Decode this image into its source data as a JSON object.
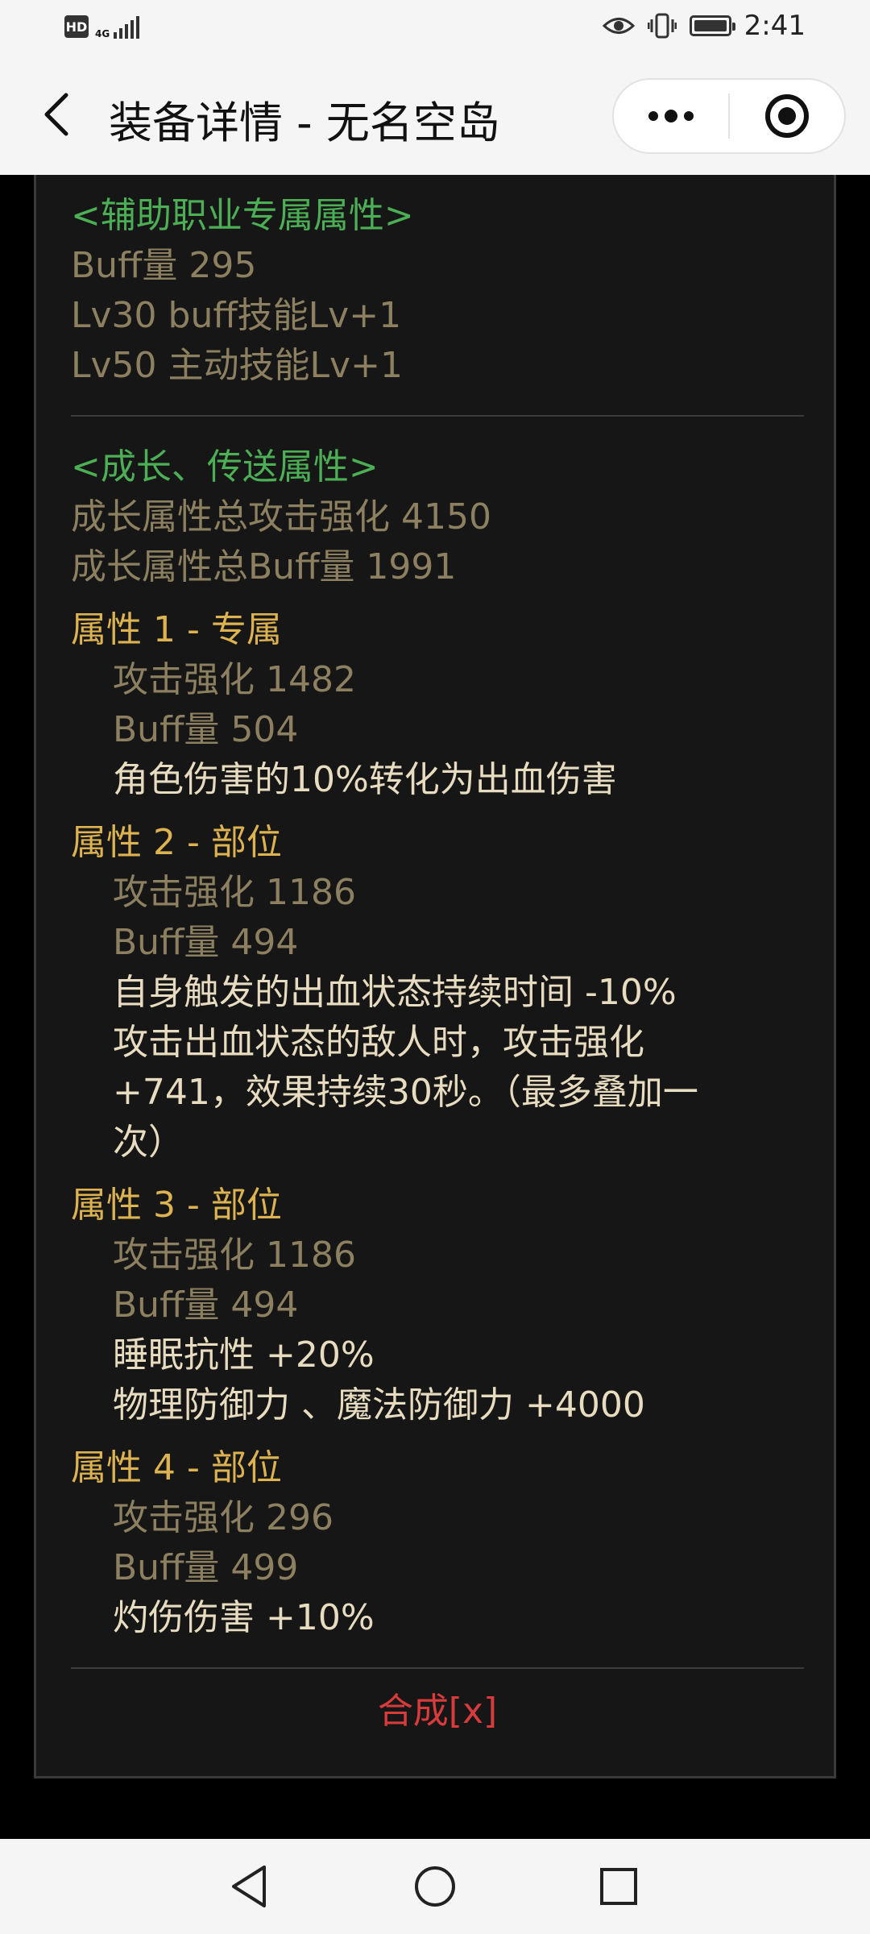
{
  "status": {
    "hd": "HD",
    "network": "4G",
    "time": "2:41"
  },
  "header": {
    "title": "装备详情 - 无名空岛",
    "more_icon": "more-dots-icon",
    "target_icon": "target-icon"
  },
  "support": {
    "heading": "<辅助职业专属属性>",
    "lines": [
      "Buff量   295",
      "Lv30 buff技能Lv+1",
      "Lv50 主动技能Lv+1"
    ]
  },
  "growth": {
    "heading": "<成长、传送属性>",
    "total_attack": "成长属性总攻击强化 4150",
    "total_buff": "成长属性总Buff量 1991"
  },
  "attributes": [
    {
      "title": "属性 1 - 专属",
      "attack": "攻击强化   1482",
      "buff": "Buff量   504",
      "effects": [
        "角色伤害的10%转化为出血伤害"
      ]
    },
    {
      "title": "属性 2 - 部位",
      "attack": "攻击强化   1186",
      "buff": "Buff量   494",
      "effects": [
        "自身触发的出血状态持续时间 -10%",
        "攻击出血状态的敌人时，攻击强化+741，效果持续30秒。（最多叠加一次）"
      ]
    },
    {
      "title": "属性 3 - 部位",
      "attack": "攻击强化   1186",
      "buff": "Buff量   494",
      "effects": [
        "睡眠抗性 +20%",
        "物理防御力 、魔法防御力 +4000"
      ]
    },
    {
      "title": "属性 4 - 部位",
      "attack": "攻击强化   296",
      "buff": "Buff量   499",
      "effects": [
        "灼伤伤害 +10%"
      ]
    }
  ],
  "footer": {
    "synthesize": "合成[x]"
  },
  "colors": {
    "heading_green": "#4caf55",
    "stat_gray": "#8c8060",
    "title_gold": "#dcb350",
    "effect_cream": "#e8dcc0",
    "action_red": "#d83b3b"
  }
}
